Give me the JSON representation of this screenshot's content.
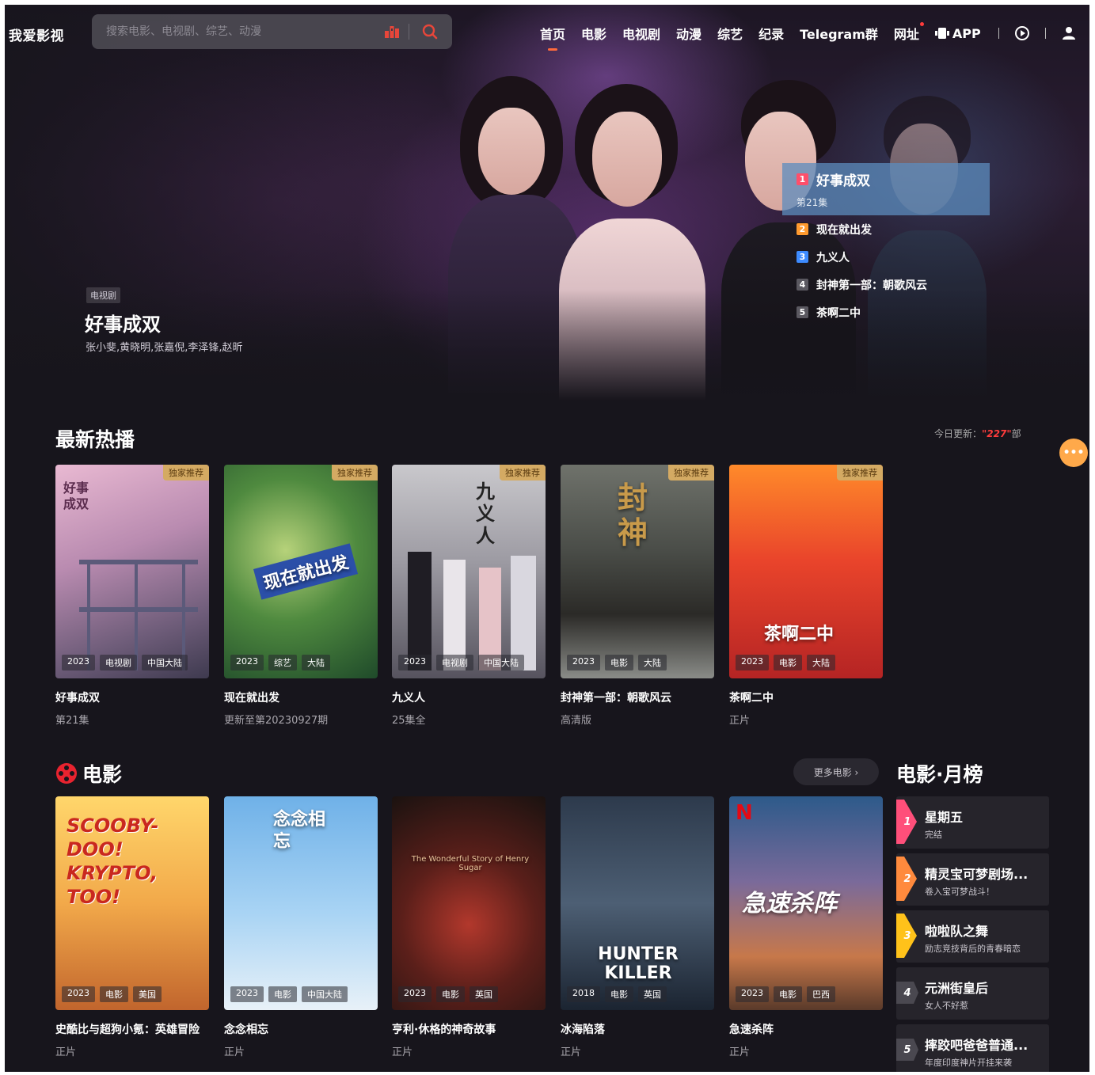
{
  "site": {
    "logo": "我爱影视"
  },
  "search": {
    "placeholder": "搜索电影、电视剧、综艺、动漫"
  },
  "nav": {
    "items": [
      "首页",
      "电影",
      "电视剧",
      "动漫",
      "综艺",
      "纪录",
      "Telegram群",
      "网址"
    ],
    "active_index": 0,
    "app_label": "APP"
  },
  "hero": {
    "tag": "电视剧",
    "title": "好事成双",
    "cast": "张小斐,黄晓明,张嘉倪,李泽锋,赵昕",
    "list": [
      {
        "rank": "1",
        "title": "好事成双",
        "sub": "第21集",
        "rank_color": "#ff4f6b"
      },
      {
        "rank": "2",
        "title": "现在就出发",
        "rank_color": "#ff9a2e"
      },
      {
        "rank": "3",
        "title": "九义人",
        "rank_color": "#3d8bff"
      },
      {
        "rank": "4",
        "title": "封神第一部：朝歌风云",
        "rank_color": "#5a5860"
      },
      {
        "rank": "5",
        "title": "茶啊二中",
        "rank_color": "#5a5860"
      }
    ]
  },
  "hot": {
    "title": "最新热播",
    "today_label": "今日更新：",
    "today_count": "\"227\"",
    "today_unit": "部",
    "badge": "独家推荐",
    "cards": [
      {
        "title": "好事成双",
        "sub": "第21集",
        "year": "2023",
        "type": "电视剧",
        "region": "中国大陆",
        "poster_text": "好事成双"
      },
      {
        "title": "现在就出发",
        "sub": "更新至第20230927期",
        "year": "2023",
        "type": "综艺",
        "region": "大陆",
        "poster_text": "现在就出发"
      },
      {
        "title": "九义人",
        "sub": "25集全",
        "year": "2023",
        "type": "电视剧",
        "region": "中国大陆",
        "poster_text": "九义人"
      },
      {
        "title": "封神第一部：朝歌风云",
        "sub": "高清版",
        "year": "2023",
        "type": "电影",
        "region": "大陆",
        "poster_text": "封神"
      },
      {
        "title": "茶啊二中",
        "sub": "正片",
        "year": "2023",
        "type": "电影",
        "region": "大陆",
        "poster_text": "茶啊二中"
      }
    ]
  },
  "movies": {
    "title": "电影",
    "more_label": "更多电影 ›",
    "cards": [
      {
        "title": "史酷比与超狗小氪：英雄冒险",
        "sub": "正片",
        "year": "2023",
        "type": "电影",
        "region": "美国",
        "poster_text": "SCOOBY-DOO! KRYPTO, TOO!"
      },
      {
        "title": "念念相忘",
        "sub": "正片",
        "year": "2023",
        "type": "电影",
        "region": "中国大陆",
        "poster_text": "念念相忘"
      },
      {
        "title": "亨利·休格的神奇故事",
        "sub": "正片",
        "year": "2023",
        "type": "电影",
        "region": "英国",
        "poster_text": "The Wonderful Story of Henry Sugar"
      },
      {
        "title": "冰海陷落",
        "sub": "正片",
        "year": "2018",
        "type": "电影",
        "region": "英国",
        "poster_text": "HUNTER KILLER"
      },
      {
        "title": "急速杀阵",
        "sub": "正片",
        "year": "2023",
        "type": "电影",
        "region": "巴西",
        "poster_text": "急速杀阵"
      }
    ]
  },
  "monthly": {
    "title": "电影·月榜",
    "items": [
      {
        "rank": "1",
        "name": "星期五",
        "desc": "完结",
        "color": "#ff4f7a"
      },
      {
        "rank": "2",
        "name": "精灵宝可梦剧场...",
        "desc": "卷入宝可梦战斗！",
        "color": "#ff8a3d"
      },
      {
        "rank": "3",
        "name": "啦啦队之舞",
        "desc": "励志竞技背后的青春暗恋",
        "color": "#ffc21a"
      },
      {
        "rank": "4",
        "name": "元洲街皇后",
        "desc": "女人不好惹",
        "color": "#4a4850"
      },
      {
        "rank": "5",
        "name": "摔跤吧爸爸普通...",
        "desc": "年度印度神片开挂来袭",
        "color": "#4a4850"
      }
    ]
  },
  "colors": {
    "accent": "#ff6a3c",
    "background": "#17151c",
    "badge": "#d4aa63",
    "float_button": "#ffa94a"
  }
}
